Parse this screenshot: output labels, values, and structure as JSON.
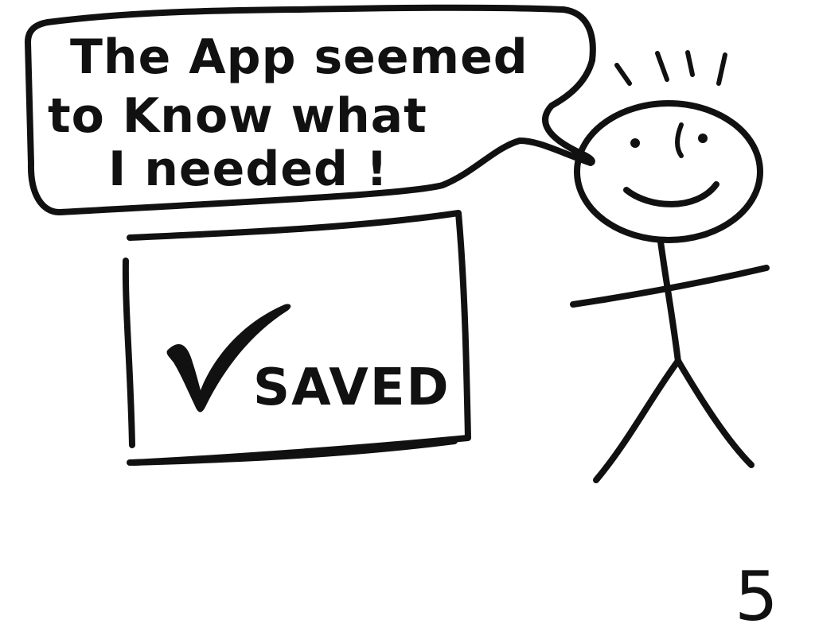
{
  "speech_bubble": {
    "lines": [
      "The App seemed",
      "to Know what",
      "I needed !"
    ]
  },
  "saved_panel": {
    "label": "SAVED",
    "icon": "checkmark-icon"
  },
  "page_number": "5",
  "character": {
    "icon": "stick-figure-icon",
    "expression": "smiling"
  },
  "colors": {
    "ink": "#111111",
    "paper": "#ffffff"
  }
}
